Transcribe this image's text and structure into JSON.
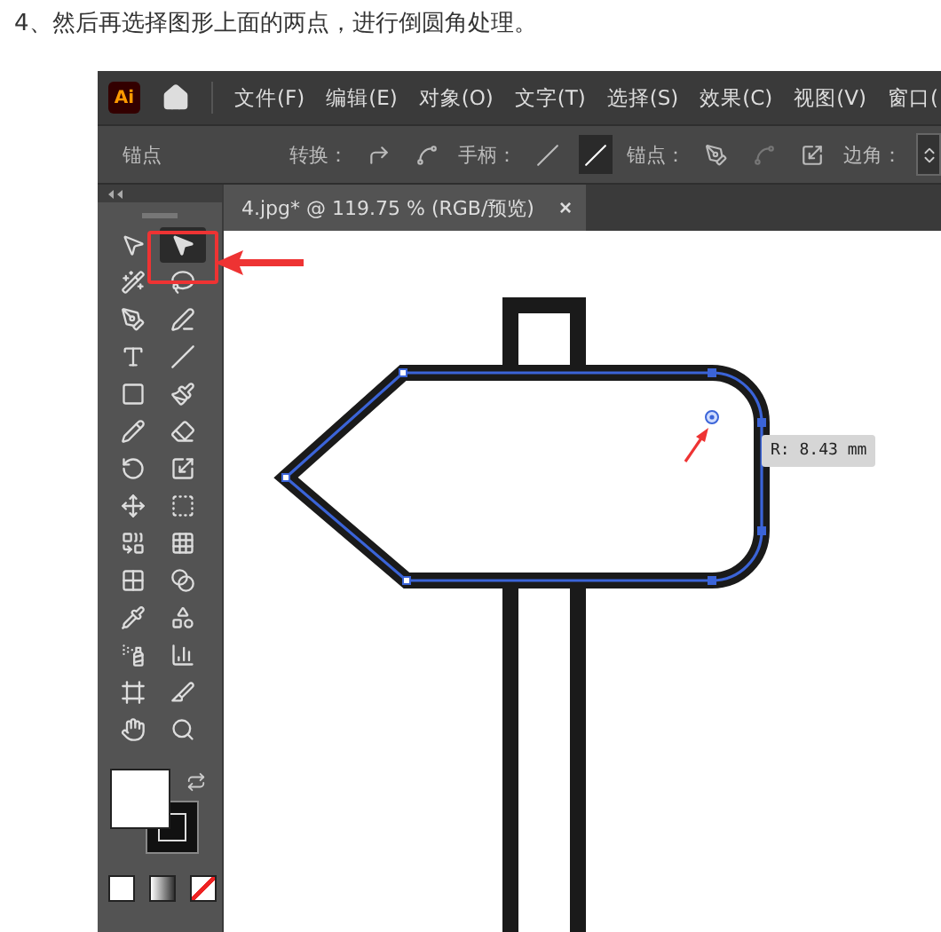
{
  "intro": "4、然后再选择图形上面的两点，进行倒圆角处理。",
  "app": {
    "logo": "Ai",
    "menu": [
      "文件(F)",
      "编辑(E)",
      "对象(O)",
      "文字(T)",
      "选择(S)",
      "效果(C)",
      "视图(V)",
      "窗口("
    ],
    "control_bar": {
      "mode": "锚点",
      "convert_label": "转换：",
      "handles_label": "手柄：",
      "handles": [
        {
          "selected": false
        },
        {
          "selected": true
        }
      ],
      "anchors_label": "锚点：",
      "corners_label": "边角："
    },
    "tools": [
      {
        "selected": false
      },
      {
        "selected": true
      },
      {
        "selected": false
      },
      {
        "selected": false
      },
      {
        "selected": false
      },
      {
        "selected": false
      },
      {
        "selected": false
      },
      {
        "selected": false
      },
      {
        "selected": false
      },
      {
        "selected": false
      },
      {
        "selected": false
      },
      {
        "selected": false
      },
      {
        "selected": false
      },
      {
        "selected": false
      },
      {
        "selected": false
      },
      {
        "selected": false
      },
      {
        "selected": false
      },
      {
        "selected": false
      },
      {
        "selected": false
      },
      {
        "selected": false
      },
      {
        "selected": false
      },
      {
        "selected": false
      },
      {
        "selected": false
      },
      {
        "selected": false
      },
      {
        "selected": false
      },
      {
        "selected": false
      },
      {
        "selected": false
      },
      {
        "selected": false
      }
    ],
    "document_tab": {
      "title": "4.jpg* @ 119.75 % (RGB/预览)",
      "close": "×"
    },
    "tooltip": "R: 8.43 mm"
  }
}
